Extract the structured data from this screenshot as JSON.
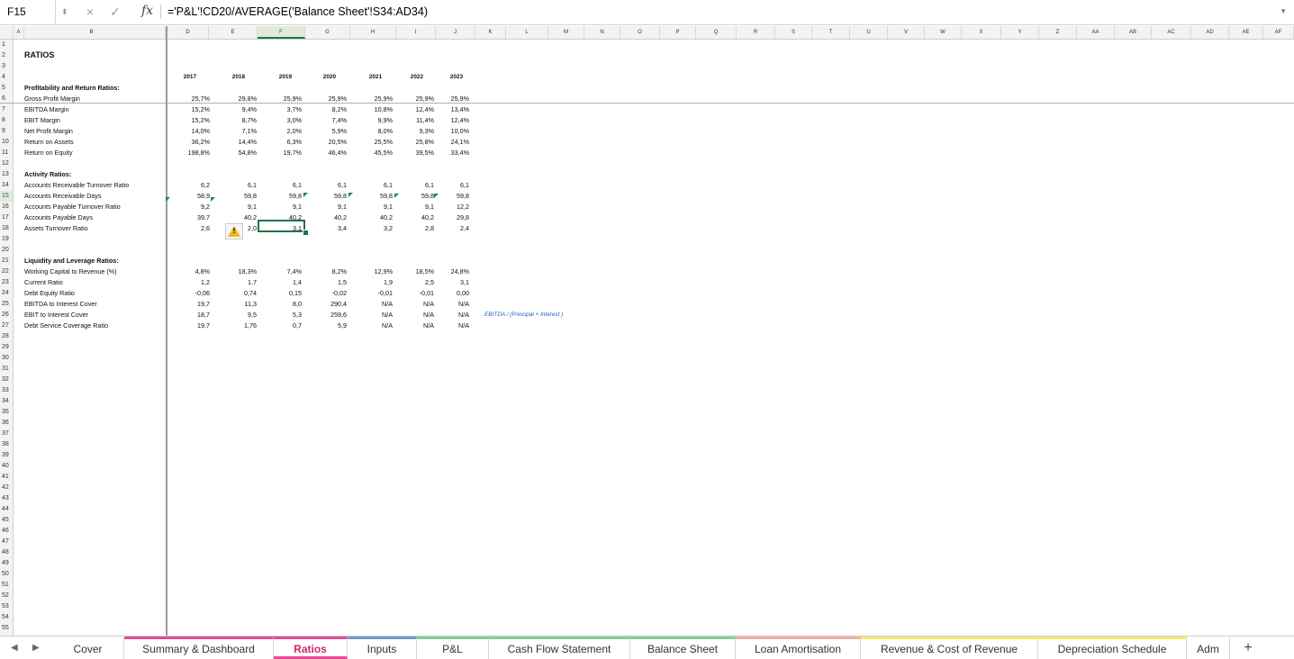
{
  "formula_bar": {
    "name_box": "F15",
    "cancel_icon": "×",
    "confirm_icon": "✓",
    "fx_label": "fx",
    "formula": "='P&L'!CD20/AVERAGE('Balance Sheet'!S34:AD34)",
    "dropdown_icon": "▼",
    "spin_icon": "⬍"
  },
  "columns": [
    "A",
    "B",
    "D",
    "E",
    "F",
    "G",
    "H",
    "I",
    "J",
    "K",
    "L",
    "M",
    "N",
    "O",
    "P",
    "Q",
    "R",
    "S",
    "T",
    "U",
    "V",
    "W",
    "X",
    "Y",
    "Z",
    "AA",
    "AB",
    "AC",
    "AD",
    "AE",
    "AF"
  ],
  "selected_column": "F",
  "selected_row": "15",
  "rows": [
    "1",
    "2",
    "3",
    "4",
    "5",
    "6",
    "7",
    "8",
    "9",
    "10",
    "11",
    "12",
    "13",
    "14",
    "15",
    "16",
    "17",
    "18",
    "19",
    "20",
    "21",
    "22",
    "23",
    "24",
    "25",
    "26",
    "27",
    "28",
    "29",
    "30",
    "31",
    "32",
    "33",
    "34",
    "35",
    "36",
    "37",
    "38",
    "39",
    "40",
    "41",
    "42",
    "43",
    "44",
    "45",
    "46",
    "47",
    "48",
    "49",
    "50",
    "51",
    "52",
    "53",
    "54",
    "55"
  ],
  "sheet": {
    "title": "RATIOS",
    "years": [
      "2017",
      "2018",
      "2019",
      "2020",
      "2021",
      "2022",
      "2023"
    ],
    "sections": [
      {
        "header": "Profitability and Return Ratios:",
        "lines": [
          {
            "label": "Gross Profit Margin",
            "values": [
              "25,7%",
              "29,8%",
              "25,9%",
              "25,9%",
              "25,9%",
              "25,9%",
              "25,9%"
            ]
          },
          {
            "label": "EBITDA Margin",
            "values": [
              "15,2%",
              "9,4%",
              "3,7%",
              "8,2%",
              "10,8%",
              "12,4%",
              "13,4%"
            ]
          },
          {
            "label": "EBIT Margin",
            "values": [
              "15,2%",
              "8,7%",
              "3,0%",
              "7,4%",
              "9,9%",
              "11,4%",
              "12,4%"
            ]
          },
          {
            "label": "Net Profit Margin",
            "values": [
              "14,0%",
              "7,1%",
              "2,0%",
              "5,9%",
              "8,0%",
              "9,3%",
              "10,0%"
            ]
          },
          {
            "label": "Return on Assets",
            "values": [
              "36,2%",
              "14,4%",
              "6,3%",
              "20,5%",
              "25,5%",
              "25,8%",
              "24,1%"
            ]
          },
          {
            "label": "Return on Equity",
            "values": [
              "198,8%",
              "54,8%",
              "19,7%",
              "46,4%",
              "45,5%",
              "39,5%",
              "33,4%"
            ]
          }
        ]
      },
      {
        "header": "Activity Ratios:",
        "lines": [
          {
            "label": "Accounts Receivable Turnover Ratio",
            "values": [
              "6,2",
              "6,1",
              "6,1",
              "6,1",
              "6,1",
              "6,1",
              "6,1"
            ]
          },
          {
            "label": "Accounts Receivable Days",
            "values": [
              "58,9",
              "59,8",
              "59,8",
              "59,8",
              "59,8",
              "59,8",
              "59,8"
            ]
          },
          {
            "label": "Accounts Payable Turnover Ratio",
            "values": [
              "9,2",
              "9,1",
              "9,1",
              "9,1",
              "9,1",
              "9,1",
              "12,2"
            ]
          },
          {
            "label": "Accounts Payable Days",
            "values": [
              "39,7",
              "40,2",
              "40,2",
              "40,2",
              "40,2",
              "40,2",
              "29,8"
            ]
          },
          {
            "label": "Assets Turnover Ratio",
            "values": [
              "2,6",
              "2,0",
              "3,1",
              "3,4",
              "3,2",
              "2,8",
              "2,4"
            ]
          }
        ]
      },
      {
        "header": "Liquidity and Leverage Ratios:",
        "lines": [
          {
            "label": "Working Capital to  Revenue (%)",
            "values": [
              "4,8%",
              "18,3%",
              "7,4%",
              "8,2%",
              "12,9%",
              "18,5%",
              "24,8%"
            ]
          },
          {
            "label": "Current Ratio",
            "values": [
              "1,2",
              "1,7",
              "1,4",
              "1,5",
              "1,9",
              "2,5",
              "3,1"
            ]
          },
          {
            "label": "Debt Equity Ratio",
            "values": [
              "-0,06",
              "0,74",
              "0,15",
              "-0,02",
              "-0,01",
              "-0,01",
              "0,00"
            ]
          },
          {
            "label": "EBITDA to Interest Cover",
            "values": [
              "19,7",
              "11,3",
              "8,0",
              "290,4",
              "N/A",
              "N/A",
              "N/A"
            ]
          },
          {
            "label": "EBIT to Interest Cover",
            "values": [
              "18,7",
              "9,5",
              "5,3",
              "259,6",
              "N/A",
              "N/A",
              "N/A"
            ]
          },
          {
            "label": "Debt Service Coverage Ratio",
            "values": [
              "19,7",
              "1,76",
              "0,7",
              "5,9",
              "N/A",
              "N/A",
              "N/A"
            ]
          }
        ]
      }
    ],
    "note": "EBITDA / (Principal + Interest )",
    "warning_icon": "!"
  },
  "tabs": {
    "nav_prev": "◀",
    "nav_next": "▶",
    "add": "+",
    "items": [
      {
        "label": "Cover",
        "color": "#ffffff"
      },
      {
        "label": "Summary & Dashboard",
        "color": "#e64a95"
      },
      {
        "label": "Ratios",
        "color": "#e64a95"
      },
      {
        "label": "Inputs",
        "color": "#6b9bd2"
      },
      {
        "label": "P&L",
        "color": "#7fcf9a"
      },
      {
        "label": "Cash Flow Statement",
        "color": "#7fcf9a"
      },
      {
        "label": "Balance Sheet",
        "color": "#7fcf9a"
      },
      {
        "label": "Loan Amortisation",
        "color": "#f3b1a4"
      },
      {
        "label": "Revenue & Cost of Revenue",
        "color": "#f2ea6f"
      },
      {
        "label": "Depreciation Schedule",
        "color": "#f2ea6f"
      },
      {
        "label": "Adm",
        "color": "#ffffff"
      }
    ],
    "active_index": 2
  }
}
